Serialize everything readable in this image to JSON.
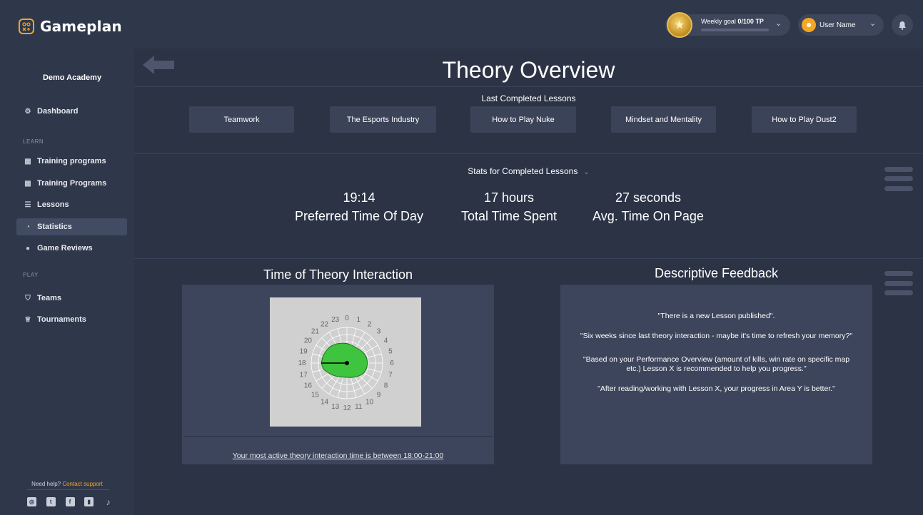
{
  "app": {
    "name": "Gameplan",
    "logo_glyph": "⚙"
  },
  "header": {
    "weekly_goal_label": "Weekly goal",
    "weekly_goal_value": "0/100 TP",
    "weekly_goal_progress": 0,
    "user_name": "User Name"
  },
  "sidebar": {
    "academy": "Demo Academy",
    "dashboard": "Dashboard",
    "learn_label": "LEARN",
    "training_programs_1": "Training programs",
    "training_programs_2": "Training Programs",
    "lessons": "Lessons",
    "statistics": "Statistics",
    "game_reviews": "Game Reviews",
    "play_label": "PLAY",
    "teams": "Teams",
    "tournaments": "Tournaments",
    "help_text": "Need help?",
    "help_link": "Contact support"
  },
  "main": {
    "title": "Theory Overview",
    "last_completed_heading": "Last Completed Lessons",
    "lessons": [
      "Teamwork",
      "The Esports Industry",
      "How to Play Nuke",
      "Mindset and Mentality",
      "How to Play Dust2"
    ],
    "stats_heading": "Stats for Completed Lessons",
    "stats": [
      {
        "value": "19:14",
        "label": "Preferred Time Of Day"
      },
      {
        "value": "17 hours",
        "label": "Total Time Spent"
      },
      {
        "value": "27 seconds",
        "label": "Avg. Time On Page"
      }
    ],
    "interaction_title": "Time of Theory Interaction",
    "active_time_text": "Your most active theory interaction time is between 18:00-21:00",
    "feedback_title": "Descriptive Feedback",
    "feedback": [
      "\"There is a new Lesson published\".",
      "\"Six weeks since last theory interaction - maybe it's time to refresh your memory?\"",
      "\"Based on your Performance Overview (amount of kills, win rate on specific map",
      "etc.) Lesson X is recommended to help you progress.\"",
      "\"After reading/working with Lesson X, your progress in Area Y is better.\""
    ]
  },
  "chart_data": {
    "type": "radar",
    "categories": [
      "0",
      "1",
      "2",
      "3",
      "4",
      "5",
      "6",
      "7",
      "8",
      "9",
      "10",
      "11",
      "12",
      "13",
      "14",
      "15",
      "16",
      "17",
      "18",
      "19",
      "20",
      "21",
      "22",
      "23"
    ],
    "values": [
      0.55,
      0.52,
      0.5,
      0.52,
      0.55,
      0.57,
      0.58,
      0.57,
      0.55,
      0.5,
      0.45,
      0.42,
      0.4,
      0.41,
      0.44,
      0.5,
      0.58,
      0.68,
      0.72,
      0.7,
      0.68,
      0.66,
      0.62,
      0.58
    ],
    "highlight_hour": 18,
    "fill_color": "#3ec43e",
    "background_color": "#d0d0d0"
  }
}
